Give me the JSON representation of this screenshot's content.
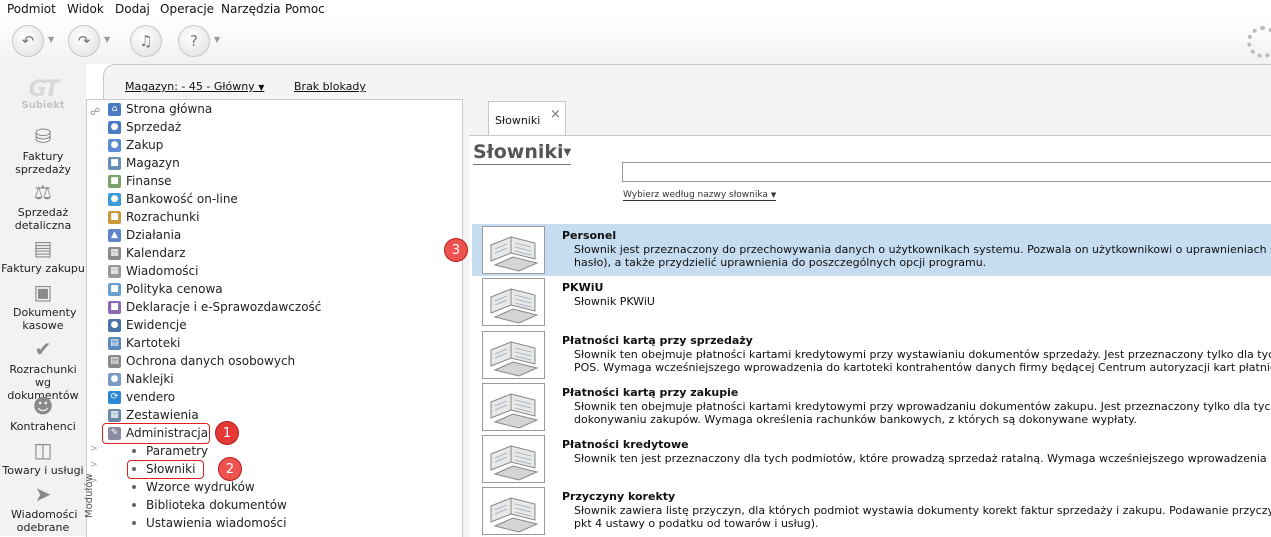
{
  "menu": [
    "Podmiot",
    "Widok",
    "Dodaj",
    "Operacje",
    "Narzędzia",
    "Pomoc"
  ],
  "toolbar": {
    "buttons": [
      "back-icon",
      "forward-icon",
      "bell-icon",
      "help-icon"
    ],
    "spinner": "loading-spinner-icon"
  },
  "logo": {
    "mark": "GT",
    "name": "Subiekt"
  },
  "modules": [
    {
      "label": "Faktury sprzedaży",
      "icon": "coins-icon"
    },
    {
      "label": "Sprzedaż detaliczna",
      "icon": "scale-icon"
    },
    {
      "label": "Faktury zakupu",
      "icon": "invoice-icon"
    },
    {
      "label": "Dokumenty kasowe",
      "icon": "cash-register-icon"
    },
    {
      "label": "Rozrachunki wg dokumentów",
      "icon": "checkmark-icon"
    },
    {
      "label": "Kontrahenci",
      "icon": "person-icon"
    },
    {
      "label": "Towary i usługi",
      "icon": "products-icon"
    },
    {
      "label": "Wiadomości odebrane",
      "icon": "inbox-icon"
    }
  ],
  "frame": {
    "warehouse": "Magazyn: - 45 - Główny",
    "block": "Brak blokady"
  },
  "nav": [
    {
      "label": "Strona główna",
      "color": "#4a7bc4"
    },
    {
      "label": "Sprzedaż",
      "color": "#4a7bc4"
    },
    {
      "label": "Zakup",
      "color": "#5b8bd0"
    },
    {
      "label": "Magazyn",
      "color": "#6a8fb5"
    },
    {
      "label": "Finanse",
      "color": "#7aa36a"
    },
    {
      "label": "Bankowość on-line",
      "color": "#3c9ad6"
    },
    {
      "label": "Rozrachunki",
      "color": "#c89a3a"
    },
    {
      "label": "Działania",
      "color": "#5a86c8"
    },
    {
      "label": "Kalendarz",
      "color": "#8a8a8a"
    },
    {
      "label": "Wiadomości",
      "color": "#9a9a9a"
    },
    {
      "label": "Polityka cenowa",
      "color": "#6aa0d0"
    },
    {
      "label": "Deklaracje i e-Sprawozdawczość",
      "color": "#8a6ab0"
    },
    {
      "label": "Ewidencje",
      "color": "#4a74a8"
    },
    {
      "label": "Kartoteki",
      "color": "#5a8ac0"
    },
    {
      "label": "Ochrona danych osobowych",
      "color": "#8a8a8a"
    },
    {
      "label": "Naklejki",
      "color": "#7a9ac8"
    },
    {
      "label": "vendero",
      "color": "#2a8ad6"
    },
    {
      "label": "Zestawienia",
      "color": "#6a8aa8"
    },
    {
      "label": "Administracja",
      "color": "#8a8aa0"
    }
  ],
  "subnav": [
    "Parametry",
    "Słowniki",
    "Wzorce wydruków",
    "Biblioteka dokumentów",
    "Ustawienia wiadomości"
  ],
  "strip_label": "Modułów",
  "badges": [
    "1",
    "2",
    "3"
  ],
  "tab": {
    "label": "Słowniki",
    "close": "×"
  },
  "panel": {
    "title": "Słowniki",
    "choose": "Wybierz według nazwy słownika"
  },
  "dictionaries": [
    {
      "title": "Personel",
      "desc": [
        "Słownik jest przeznaczony do przechowywania danych o użytkownikach systemu. Pozwala on użytkownikowi o uprawnieniach szefa firm",
        "hasło), a także przydzielić uprawnienia do poszczególnych opcji programu."
      ]
    },
    {
      "title": "PKWiU",
      "desc": [
        "Słownik PKWiU",
        ""
      ]
    },
    {
      "title": "Płatności kartą przy sprzedaży",
      "desc": [
        "Słownik ten obejmuje płatności kartami kredytowymi przy wystawianiu dokumentów sprzedaży. Jest przeznaczony tylko dla tych podmio",
        "POS. Wymaga wcześniejszego wprowadzenia do kartoteki kontrahentów danych firmy będącej Centrum autoryzacji kart płatniczych."
      ]
    },
    {
      "title": "Płatności kartą przy zakupie",
      "desc": [
        "Słownik ten obejmuje płatności kartami kredytowymi przy wprowadzaniu dokumentów zakupu. Jest przeznaczony tylko dla tych podmic",
        "dokonywaniu zakupów. Wymaga określenia rachunków bankowych, z których są dokonywane wypłaty."
      ]
    },
    {
      "title": "Płatności kredytowe",
      "desc": [
        "Słownik ten jest przeznaczony dla tych podmiotów, które prowadzą sprzedaż ratalną. Wymaga wcześniejszego wprowadzenia kontrahen",
        ""
      ]
    },
    {
      "title": "Przyczyny korekty",
      "desc": [
        "Słownik zawiera listę przyczyn, dla których podmiot wystawia dokumenty korekt faktur sprzedaży i zakupu. Podawanie przyczyn wystawi",
        "pkt 4 ustawy o podatku od towarów i usług)."
      ]
    }
  ]
}
